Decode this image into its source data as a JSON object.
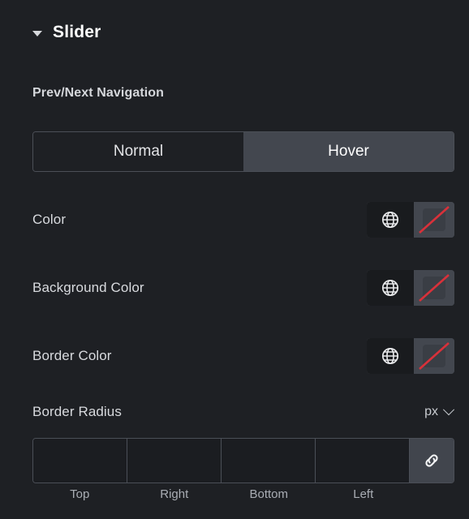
{
  "section": {
    "title": "Slider",
    "caret_icon": "caret-down-icon",
    "expanded": true
  },
  "sub_label": "Prev/Next Navigation",
  "tabs": {
    "items": [
      {
        "label": "Normal",
        "active": false
      },
      {
        "label": "Hover",
        "active": true
      }
    ]
  },
  "controls": [
    {
      "label": "Color",
      "globe_icon": "globe-icon",
      "swatch_state": "no-color",
      "slash_color": "#d8313a"
    },
    {
      "label": "Background Color",
      "globe_icon": "globe-icon",
      "swatch_state": "no-color",
      "slash_color": "#d8313a"
    },
    {
      "label": "Border Color",
      "globe_icon": "globe-icon",
      "swatch_state": "no-color",
      "slash_color": "#d8313a"
    }
  ],
  "border_radius": {
    "label": "Border Radius",
    "unit": "px",
    "unit_chevron_icon": "chevron-down-icon",
    "link_icon": "link-icon",
    "linked": true,
    "fields": [
      {
        "name": "top",
        "label": "Top",
        "value": "",
        "placeholder": ""
      },
      {
        "name": "right",
        "label": "Right",
        "value": "",
        "placeholder": ""
      },
      {
        "name": "bottom",
        "label": "Bottom",
        "value": "",
        "placeholder": ""
      },
      {
        "name": "left",
        "label": "Left",
        "value": "",
        "placeholder": ""
      }
    ]
  },
  "theme": {
    "background": "#1e2024",
    "panel_border": "#4b4f57",
    "tab_active_bg": "#43474f",
    "text_primary": "#ffffff",
    "text_secondary": "#d8dade",
    "text_muted": "#a9adb4",
    "accent_red": "#d8313a"
  }
}
